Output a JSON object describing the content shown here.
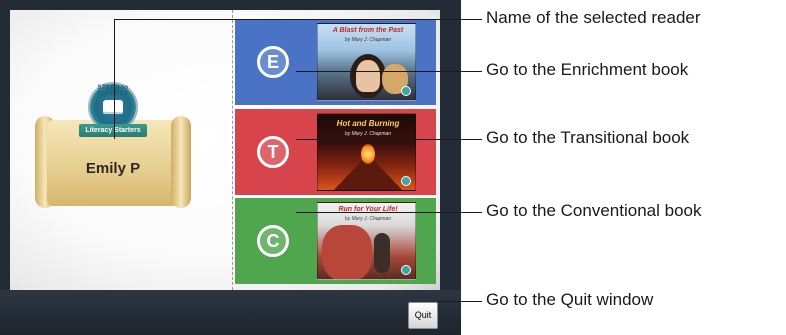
{
  "reader": {
    "name": "Emily P",
    "logo_text": "STEPS to FLUENCY",
    "logo_banner": "Literacy Starters"
  },
  "books": [
    {
      "level": "E",
      "title": "A Blast from the Past",
      "author": "by Mary J. Chapman",
      "color": "#4a73c6"
    },
    {
      "level": "T",
      "title": "Hot and Burning",
      "author": "by Mary J. Chapman",
      "color": "#d8444c"
    },
    {
      "level": "C",
      "title": "Run for Your Life!",
      "author": "by Mary J. Chapman",
      "color": "#4fa64e"
    }
  ],
  "quit_label": "Quit",
  "callouts": {
    "reader_name": "Name of the selected reader",
    "enrichment": "Go to the Enrichment book",
    "transitional": "Go to the Transitional book",
    "conventional": "Go to the Conventional book",
    "quit": "Go to the Quit window"
  }
}
